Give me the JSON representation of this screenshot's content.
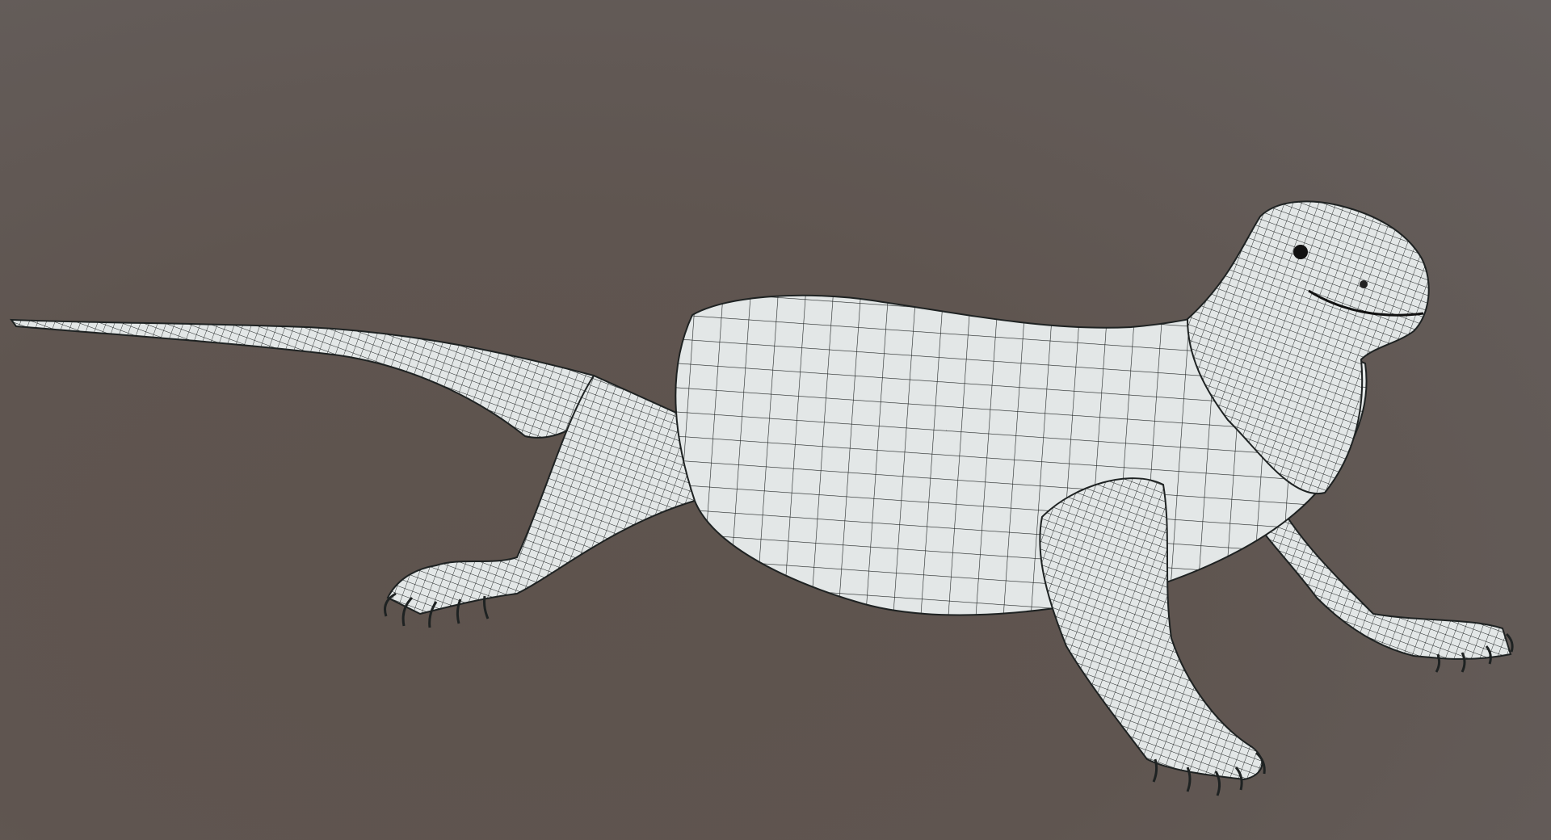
{
  "scene": {
    "subject": "lizard-wireframe-model",
    "colors": {
      "background": "#5f5550",
      "mesh_fill": "#e3e7e7",
      "wire": "#1e2222"
    }
  }
}
